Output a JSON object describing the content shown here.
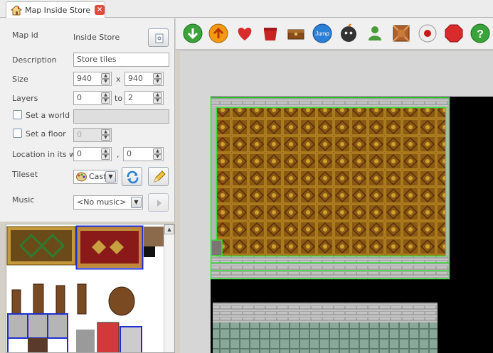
{
  "tab": {
    "title": "Map Inside Store",
    "close": "×"
  },
  "form": {
    "map_id_label": "Map id",
    "map_id_value": "Inside Store",
    "description_label": "Description",
    "description_value": "Store tiles",
    "size_label": "Size",
    "size_w": "940",
    "size_x": "x",
    "size_h": "940",
    "layers_label": "Layers",
    "layers_from": "0",
    "layers_to_label": "to",
    "layers_to": "2",
    "set_world_label": "Set a world",
    "set_floor_label": "Set a floor",
    "floor_value": "0",
    "location_label": "Location in its w",
    "location_x": "0",
    "location_sep": ",",
    "location_y": "0",
    "tileset_label": "Tileset",
    "tileset_value": "Cast",
    "music_label": "Music",
    "music_value": "<No music>"
  },
  "toolbar": {
    "tools": [
      "down-arrow-icon",
      "up-arrow-icon",
      "heart-icon",
      "pot-icon",
      "chest-icon",
      "jump-icon",
      "bomb-icon",
      "person-icon",
      "block-icon",
      "record-icon",
      "stop-icon",
      "help-icon"
    ],
    "jump_text": "Jump",
    "help_text": "?",
    "colors": {
      "green": "#3aa33a",
      "orange": "#f39a12",
      "red": "#d92b2b",
      "blue": "#2a7fd6",
      "selection": "#36e036",
      "floor": "#8a5a12"
    }
  }
}
